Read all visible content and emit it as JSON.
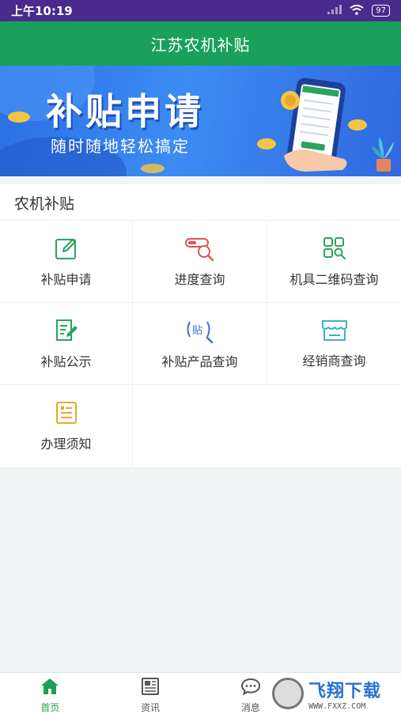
{
  "status_bar": {
    "time": "上午10:19",
    "battery": "97"
  },
  "header": {
    "title": "江苏农机补贴"
  },
  "banner": {
    "title": "补贴申请",
    "subtitle": "随时随地轻松搞定"
  },
  "section": {
    "title": "农机补贴",
    "items": [
      {
        "label": "补贴申请",
        "icon": "edit-icon",
        "color": "#2aa35e"
      },
      {
        "label": "进度查询",
        "icon": "progress-search-icon",
        "color": "#e05252"
      },
      {
        "label": "机具二维码查询",
        "icon": "qrcode-search-icon",
        "color": "#2aa35e"
      },
      {
        "label": "补贴公示",
        "icon": "document-edit-icon",
        "color": "#2aa35e"
      },
      {
        "label": "补贴产品查询",
        "icon": "subsidy-search-icon",
        "color": "#3d6fd6"
      },
      {
        "label": "经销商查询",
        "icon": "store-icon",
        "color": "#3fb0c8"
      },
      {
        "label": "办理须知",
        "icon": "notice-icon",
        "color": "#e8a82a"
      }
    ]
  },
  "bottom_nav": {
    "items": [
      {
        "label": "首页",
        "icon": "home-icon"
      },
      {
        "label": "资讯",
        "icon": "news-icon"
      },
      {
        "label": "消息",
        "icon": "message-icon"
      }
    ]
  },
  "watermark": {
    "top": "飞翔下载",
    "bottom": "WWW.FXXZ.COM"
  }
}
